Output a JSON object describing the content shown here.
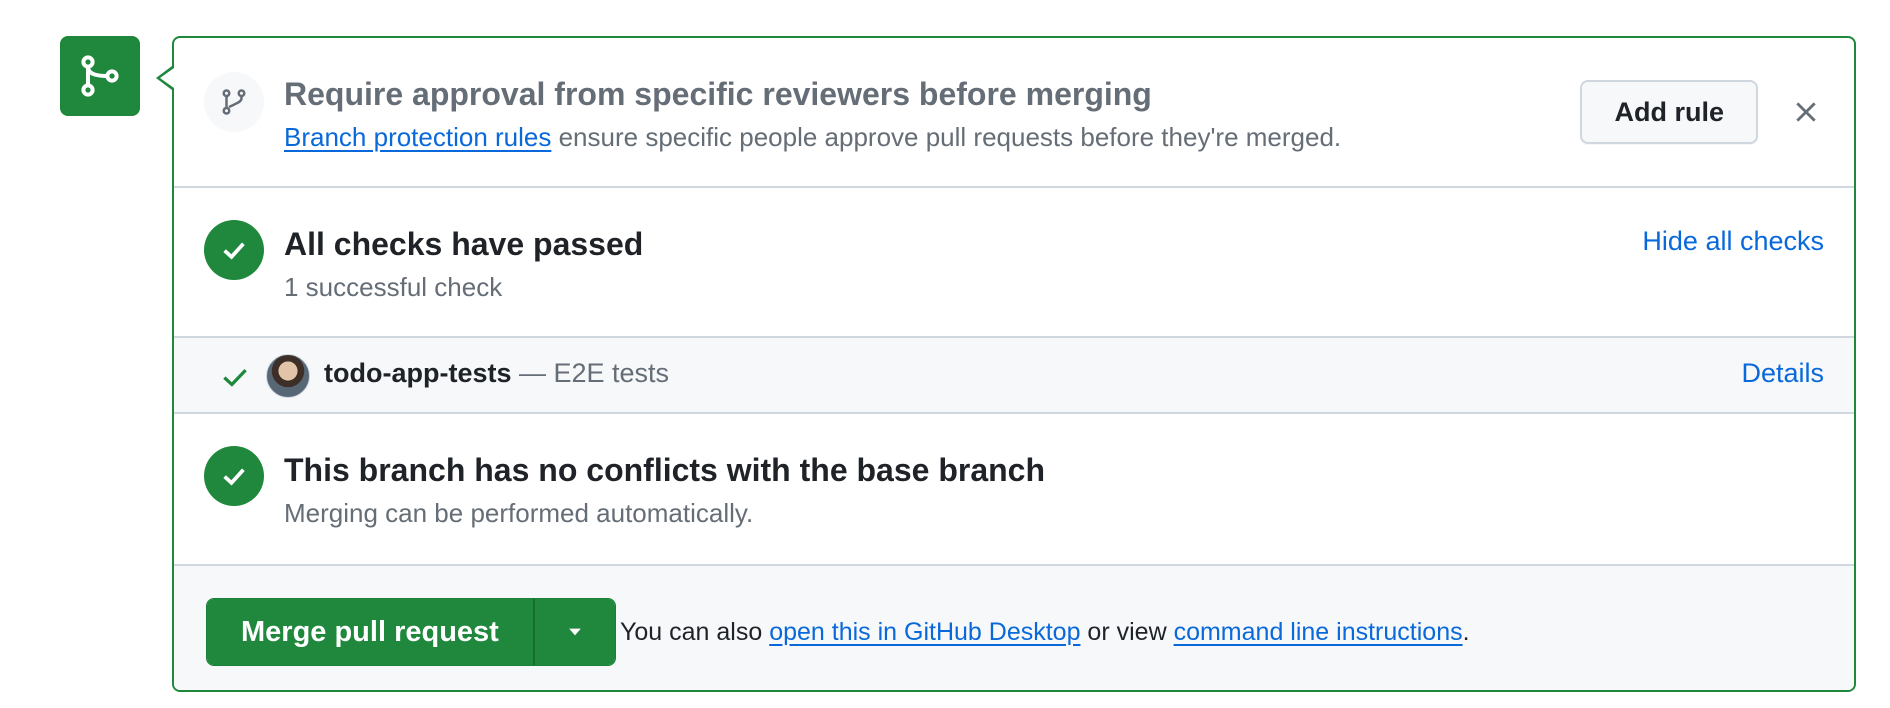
{
  "protection": {
    "title": "Require approval from specific reviewers before merging",
    "link_text": "Branch protection rules",
    "desc_text": " ensure specific people approve pull requests before they're merged.",
    "add_rule_label": "Add rule",
    "icon": "git-branch-icon",
    "close_icon": "close-icon"
  },
  "checks": {
    "title": "All checks have passed",
    "subtitle": "1 successful check",
    "toggle_label": "Hide all checks",
    "items": [
      {
        "name": "todo-app-tests",
        "description": " — E2E tests",
        "details_label": "Details",
        "status": "success"
      }
    ]
  },
  "conflicts": {
    "title": "This branch has no conflicts with the base branch",
    "subtitle": "Merging can be performed automatically."
  },
  "merge": {
    "button_label": "Merge pull request",
    "hint_prefix": "You can also ",
    "desktop_link": "open this in GitHub Desktop",
    "hint_middle": " or view ",
    "cli_link": "command line instructions",
    "hint_suffix": "."
  },
  "colors": {
    "success_green": "#1f883d",
    "link_blue": "#0969da",
    "muted_text": "#656d76",
    "border": "#d0d7de"
  }
}
